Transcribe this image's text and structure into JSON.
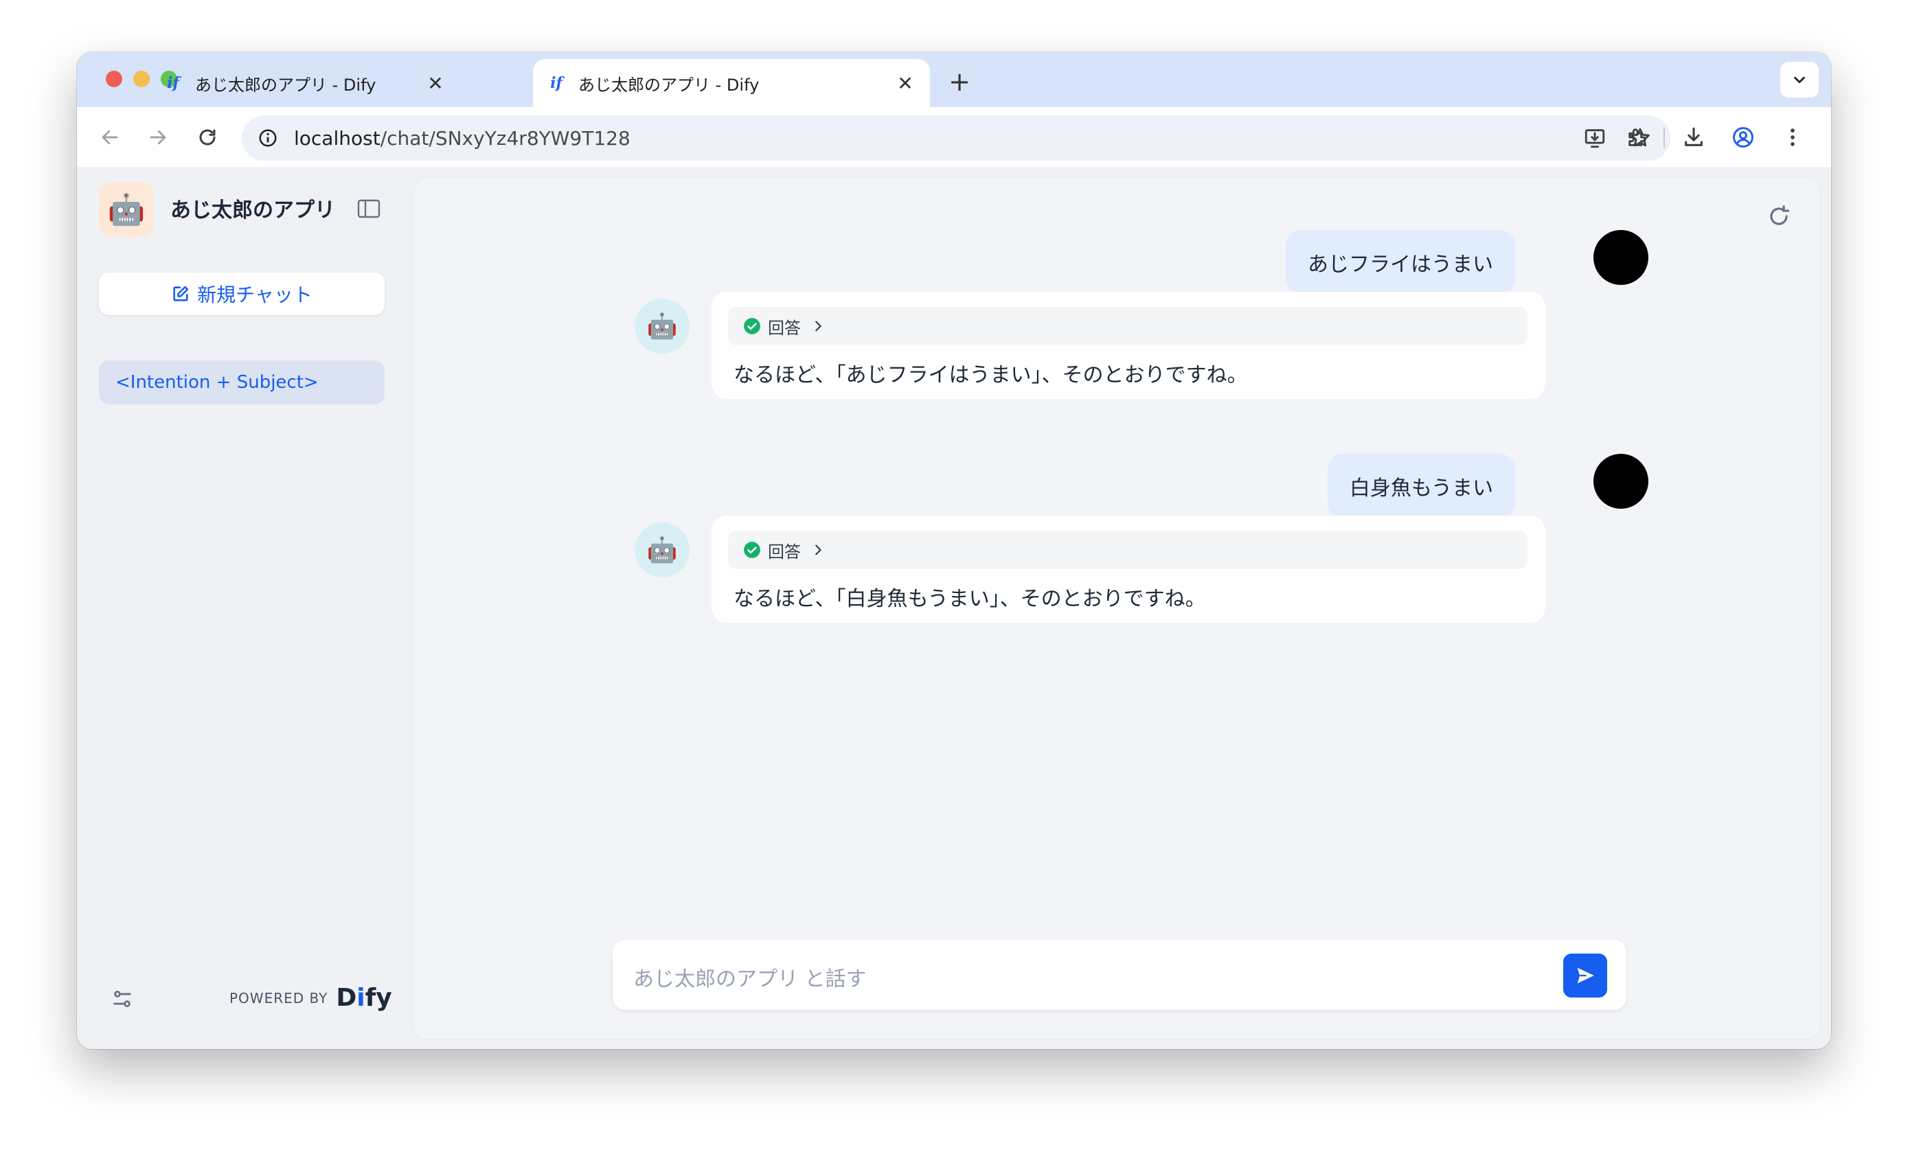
{
  "browser": {
    "tabs": [
      {
        "title": "あじ太郎のアプリ - Dify",
        "favicon": "if",
        "active": false
      },
      {
        "title": "あじ太郎のアプリ - Dify",
        "favicon": "if",
        "active": true
      }
    ],
    "new_tab_label": "+",
    "close_label": "✕",
    "url_host": "localhost",
    "url_path": "/chat/SNxyYz4r8YW9T128"
  },
  "sidebar": {
    "app_name": "あじ太郎のアプリ",
    "app_icon": "🤖",
    "new_chat_label": "新規チャット",
    "conversations": [
      {
        "label": "<Intention + Subject>"
      }
    ],
    "powered_by": "POWERED BY",
    "brand": {
      "prefix": "D",
      "dot": "i",
      "suffix": "fy"
    }
  },
  "chat": {
    "messages": [
      {
        "role": "user",
        "text": "あじフライはうまい"
      },
      {
        "role": "bot",
        "workflow_label": "回答",
        "text": "なるほど、「あじフライはうまい」、そのとおりですね。"
      },
      {
        "role": "user",
        "text": "白身魚もうまい"
      },
      {
        "role": "bot",
        "workflow_label": "回答",
        "text": "なるほど、「白身魚もうまい」、そのとおりですね。"
      }
    ],
    "input_placeholder": "あじ太郎のアプリ と話す"
  },
  "colors": {
    "accent": "#155eef",
    "tab_strip": "#d7e3f8",
    "user_bubble": "#e1ecfd",
    "success": "#17b26a"
  }
}
